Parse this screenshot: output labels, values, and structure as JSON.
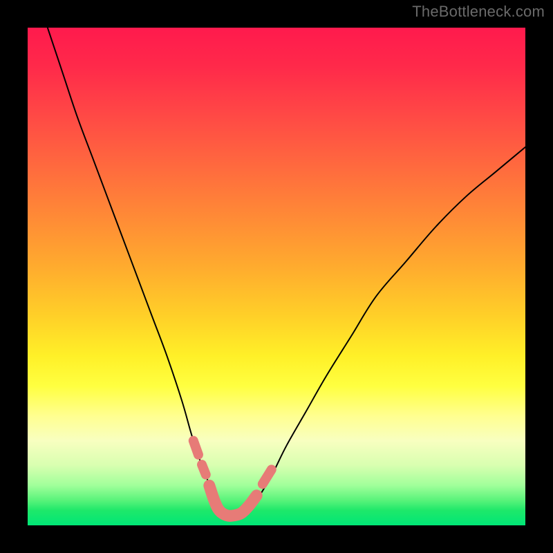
{
  "watermark": "TheBottleneck.com",
  "colors": {
    "curve": "#000000",
    "trough": "#e77b77",
    "background_top": "#ff1a4d",
    "background_bottom": "#00e676",
    "frame": "#000000"
  },
  "chart_data": {
    "type": "line",
    "title": "",
    "xlabel": "",
    "ylabel": "",
    "xlim": [
      0,
      100
    ],
    "ylim": [
      0,
      100
    ],
    "grid": false,
    "legend": false,
    "note": "Values are estimated from pixel positions; axes have no printed ticks. y=100 top of colored area, y=0 bottom. Curve descends steeply from top-left, bottoms near x≈38–44 at y≈2, then rises concavely to top-right.",
    "series": [
      {
        "name": "left_branch",
        "x": [
          4,
          7,
          10,
          13,
          16,
          19,
          22,
          25,
          28,
          31,
          33,
          35,
          37,
          38,
          39
        ],
        "y": [
          100,
          91,
          82,
          74,
          66,
          58,
          50,
          42,
          34,
          25,
          18,
          12,
          7,
          4,
          2
        ]
      },
      {
        "name": "right_branch",
        "x": [
          44,
          46,
          49,
          52,
          56,
          60,
          65,
          70,
          76,
          82,
          88,
          94,
          100
        ],
        "y": [
          2,
          5,
          10,
          16,
          23,
          30,
          38,
          46,
          53,
          60,
          66,
          71,
          76
        ]
      },
      {
        "name": "trough_highlight_main",
        "x": [
          36.5,
          37.5,
          38.5,
          40,
          41.5,
          43,
          44.5,
          46
        ],
        "y": [
          8,
          5,
          3,
          2,
          2,
          2.5,
          4,
          6
        ]
      },
      {
        "name": "trough_bead_left_upper",
        "x": [
          33.3,
          34.3
        ],
        "y": [
          17,
          14.2
        ]
      },
      {
        "name": "trough_bead_left_lower",
        "x": [
          35.0,
          35.8
        ],
        "y": [
          12.2,
          10.2
        ]
      },
      {
        "name": "trough_bead_right",
        "x": [
          47.2,
          49.0
        ],
        "y": [
          8.3,
          11.2
        ]
      }
    ],
    "highlight_style": {
      "stroke": "#e77b77",
      "stroke_width_main": 17,
      "stroke_width_bead": 14
    }
  }
}
